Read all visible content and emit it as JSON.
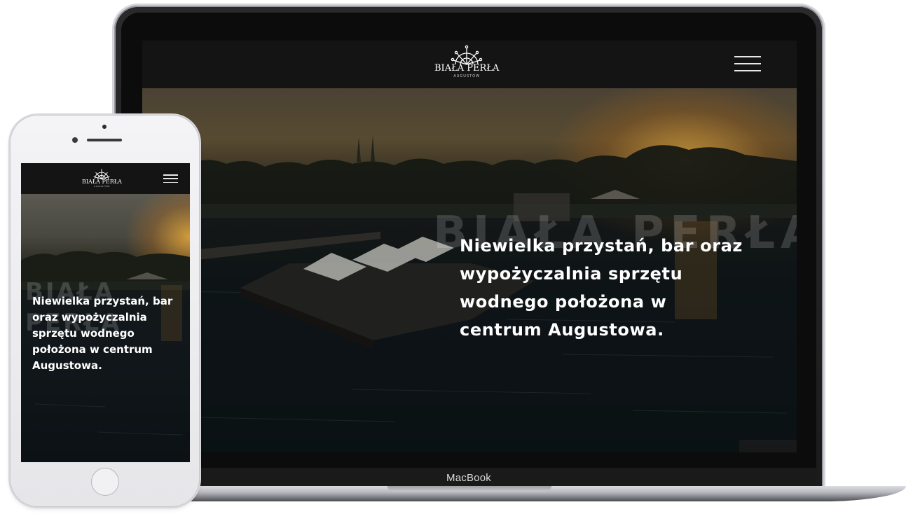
{
  "brand": {
    "name": "BIAŁA PERŁA",
    "subtitle": "AUGUSTÓW",
    "logo_icon": "ship-wheel-icon"
  },
  "laptop": {
    "device_label": "MacBook",
    "menu_icon": "hamburger-icon",
    "hero": {
      "watermark": "BIAŁA PERŁA",
      "headline": "Niewielka przystań, bar oraz wypożyczalnia sprzętu wodnego położona w centrum Augustowa."
    }
  },
  "phone": {
    "menu_icon": "hamburger-icon",
    "hero": {
      "watermark": "BIAŁA PERŁA",
      "headline": "Niewielka przystań, bar oraz wypożyczalnia sprzętu wodnego położona w centrum Augustowa."
    }
  },
  "colors": {
    "header_bg": "#141414",
    "text": "#ffffff",
    "sun": "#ffbe46"
  }
}
